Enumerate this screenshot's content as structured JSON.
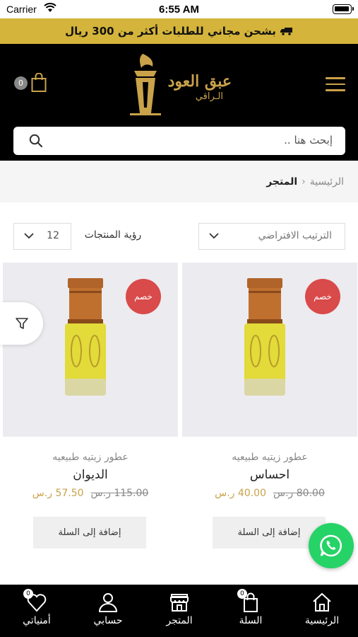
{
  "status_bar": {
    "carrier": "Carrier",
    "time": "6:55 AM"
  },
  "promo": {
    "text": "بشحن مجاني للطلبات أكثر من 300 ريال",
    "icon": "truck-icon"
  },
  "header": {
    "logo_title": "عبق العود",
    "logo_subtitle": "الـراقي",
    "cart_count": "0",
    "brand_color": "#c9a24a"
  },
  "search": {
    "placeholder": "إبحث هنا .."
  },
  "breadcrumb": {
    "home": "الرئيسية",
    "separator": "‹",
    "current": "المتجر"
  },
  "toolbar": {
    "sort_value": "الترتيب الافتراضي",
    "per_page_label": "رؤية المنتجات",
    "per_page_value": "12"
  },
  "products": [
    {
      "badge": "خصم",
      "category": "عطور زيتيه طبيعيه",
      "name": "احساس",
      "old_price": "80.00 ر.س",
      "new_price": "40.00 ر.س",
      "add_label": "إضافة إلى السلة"
    },
    {
      "badge": "خصم",
      "category": "عطور زيتيه طبيعيه",
      "name": "الديوان",
      "old_price": "115.00 ر.س",
      "new_price": "57.50 ر.س",
      "add_label": "إضافة إلى السلة"
    }
  ],
  "tabbar": {
    "home": "الرئيسية",
    "cart": "السلة",
    "cart_count": "0",
    "store": "المتجر",
    "account": "حسابي",
    "wishlist": "أمنياتي",
    "wishlist_count": "0"
  },
  "colors": {
    "promo_bg": "#d4b43a",
    "sale_badge": "#d94a4a",
    "whatsapp": "#25d366"
  }
}
